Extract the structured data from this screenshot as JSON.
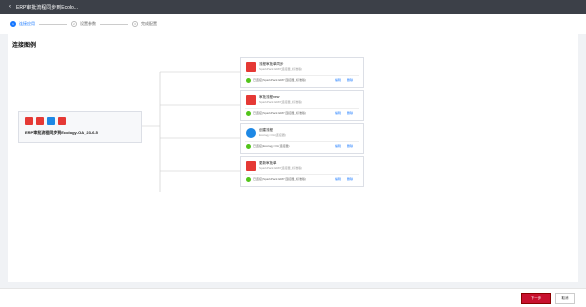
{
  "topbar": {
    "back_icon": "chevron-left-icon",
    "title": "ERP审批流程同步到Ecolo..."
  },
  "steps": [
    {
      "number": "1",
      "label": "连接应用"
    },
    {
      "number": "2",
      "label": "设置参数"
    },
    {
      "number": "3",
      "label": "完成配置"
    }
  ],
  "page": {
    "title": "连接图例"
  },
  "source": {
    "name": "ERP审批流程同步到Ecology-OA_23-6-5",
    "logo_colors": [
      "#e53935",
      "#e53935",
      "#1e88e5",
      "#e53935"
    ]
  },
  "targets": [
    {
      "name": "流程审批单同步",
      "sub": "SparkPack ERP(连接器_标准版)",
      "status": "已连接(SparkPack ERP 连接器_标准版)",
      "edit": "编辑",
      "delete": "删除",
      "icon_color": "#e53935"
    },
    {
      "name": "审批流程new",
      "sub": "SparkPack ERP(连接器_标准版)",
      "status": "已连接(SparkPack ERP 连接器_标准版)",
      "edit": "编辑",
      "delete": "删除",
      "icon_color": "#e53935"
    },
    {
      "name": "创建流程",
      "sub": "Ecology OA(连接器)",
      "status": "已连接(Ecology OA 连接器)",
      "edit": "编辑",
      "delete": "删除",
      "icon_color": "#1e88e5"
    },
    {
      "name": "更新审批单",
      "sub": "SparkPack ERP(连接器_标准版)",
      "status": "已连接(SparkPack ERP 连接器_标准版)",
      "edit": "编辑",
      "delete": "删除",
      "icon_color": "#e53935"
    }
  ],
  "footer": {
    "next_label": "下一步",
    "cancel_label": "取消"
  }
}
